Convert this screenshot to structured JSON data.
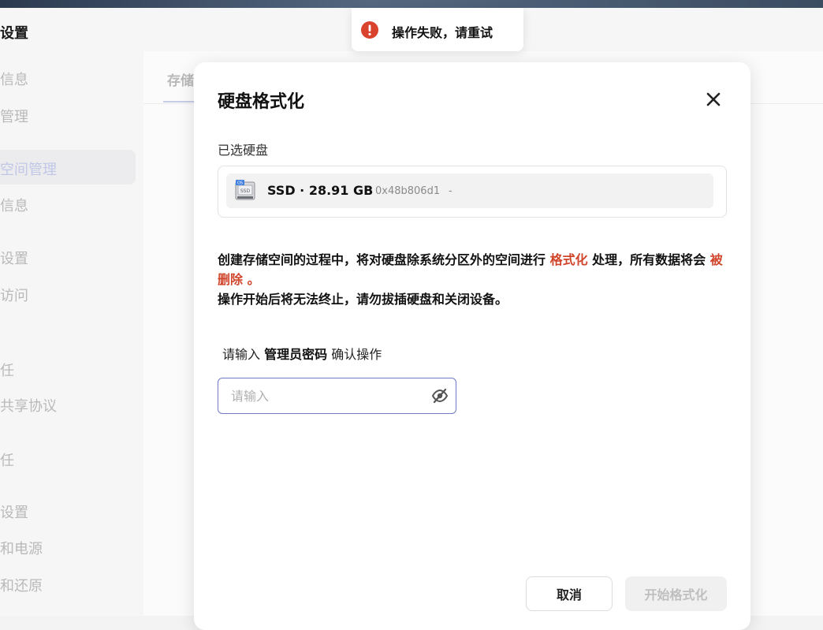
{
  "app": {
    "title": "设置"
  },
  "sidebar": {
    "items": [
      {
        "label": "信息"
      },
      {
        "label": "管理"
      },
      {
        "label": "空间管理"
      },
      {
        "label": "信息"
      },
      {
        "label": "设置"
      },
      {
        "label": "访问"
      },
      {
        "label": "任"
      },
      {
        "label": "共享协议"
      },
      {
        "label": "任"
      },
      {
        "label": "设置"
      },
      {
        "label": "和电源"
      },
      {
        "label": "和还原"
      }
    ]
  },
  "main": {
    "tab_label": "存储"
  },
  "dialog": {
    "title": "硬盘格式化",
    "selected_label": "已选硬盘",
    "disk": {
      "name": "SSD · 28.91 GB",
      "id": "0x48b806d1",
      "extra": "-",
      "icon": "ssd-disk-icon"
    },
    "warning": {
      "part1": "创建存储空间的过程中，将对硬盘除系统分区外的空间进行 ",
      "highlight1": "格式化",
      "part2": " 处理，所有数据将会 ",
      "highlight2": "被删除 。",
      "line2": "操作开始后将无法终止，请勿拔插硬盘和关闭设备。"
    },
    "password": {
      "prefix": "请输入 ",
      "bold": "管理员密码",
      "suffix": " 确认操作",
      "placeholder": "请输入",
      "value": ""
    },
    "buttons": {
      "cancel": "取消",
      "start": "开始格式化"
    }
  },
  "toast": {
    "message": "操作失败，请重试",
    "icon": "error-icon"
  },
  "colors": {
    "accent": "#6f79c8",
    "danger": "#d0452b",
    "toast_icon": "#d9432e"
  }
}
